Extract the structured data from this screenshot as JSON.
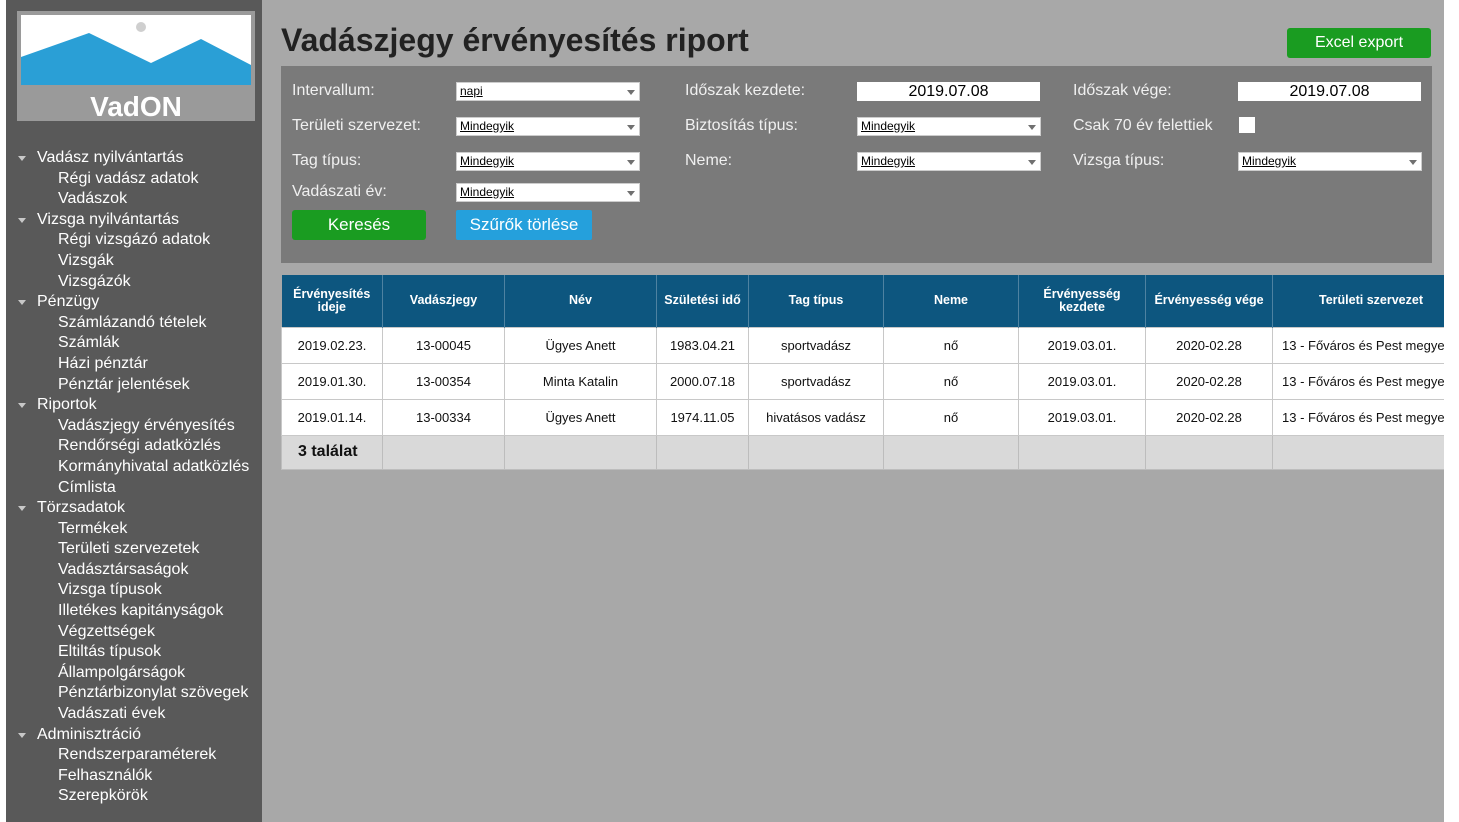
{
  "sidebar": {
    "logo_text": "VadON",
    "nav": [
      {
        "label": "Vadász nyilvántartás",
        "items": [
          "Régi vadász adatok",
          "Vadászok"
        ]
      },
      {
        "label": "Vizsga nyilvántartás",
        "items": [
          "Régi vizsgázó adatok",
          "Vizsgák",
          "Vizsgázók"
        ]
      },
      {
        "label": "Pénzügy",
        "items": [
          "Számlázandó tételek",
          "Számlák",
          "Házi pénztár",
          "Pénztár jelentések"
        ]
      },
      {
        "label": "Riportok",
        "items": [
          "Vadászjegy érvényesítés",
          "Rendőrségi adatközlés",
          "Kormányhivatal adatközlés",
          "Címlista"
        ]
      },
      {
        "label": "Törzsadatok",
        "items": [
          "Termékek",
          "Területi szervezetek",
          "Vadásztársaságok",
          "Vizsga típusok",
          "Illetékes kapitányságok",
          "Végzettségek",
          "Eltiltás típusok",
          "Állampolgárságok",
          "Pénztárbizonylat szövegek",
          "Vadászati évek"
        ]
      },
      {
        "label": "Adminisztráció",
        "items": [
          "Rendszerparaméterek",
          "Felhasználók",
          "Szerepkörök"
        ]
      }
    ]
  },
  "header": {
    "title": "Vadászjegy érvényesítés riport",
    "excel_label": "Excel export"
  },
  "filters": {
    "interval_label": "Intervallum:",
    "interval_value": "napi",
    "start_label": "Időszak kezdete:",
    "start_value": "2019.07.08",
    "end_label": "Időszak vége:",
    "end_value": "2019.07.08",
    "org_label": "Területi szervezet:",
    "org_value": "Mindegyik",
    "insurance_label": "Biztosítás típus:",
    "insurance_value": "Mindegyik",
    "over70_label": "Csak 70 év felettiek",
    "member_label": "Tag típus:",
    "member_value": "Mindegyik",
    "gender_label": "Neme:",
    "gender_value": "Mindegyik",
    "exam_label": "Vizsga típus:",
    "exam_value": "Mindegyik",
    "year_label": "Vadászati év:",
    "year_value": "Mindegyik",
    "search_label": "Keresés",
    "clear_label": "Szűrők törlése"
  },
  "table": {
    "columns": [
      "Érvényesítés ideje",
      "Vadászjegy",
      "Név",
      "Születési idő",
      "Tag típus",
      "Neme",
      "Érvényesség kezdete",
      "Érvényesség vége",
      "Területi szervezet"
    ],
    "rows": [
      [
        "2019.02.23.",
        "13-00045",
        "Ügyes Anett",
        "1983.04.21",
        "sportvadász",
        "nő",
        "2019.03.01.",
        "2020-02.28",
        "13 - Főváros és Pest megye"
      ],
      [
        "2019.01.30.",
        "13-00354",
        "Minta Katalin",
        "2000.07.18",
        "sportvadász",
        "nő",
        "2019.03.01.",
        "2020-02.28",
        "13 - Főváros és Pest megye"
      ],
      [
        "2019.01.14.",
        "13-00334",
        "Ügyes Anett",
        "1974.11.05",
        "hivatásos vadász",
        "nő",
        "2019.03.01.",
        "2020-02.28",
        "13 - Főváros és Pest megye"
      ]
    ],
    "footer_count": "3 találat"
  },
  "colors": {
    "sidebar_bg": "#595959",
    "main_bg": "#a8a8a8",
    "panel_bg": "#7a7a7a",
    "header_blue": "#0d567f",
    "green_button": "#1a9c21",
    "blue_button": "#25a0dc",
    "logo_mountain": "#2a9fd6"
  }
}
